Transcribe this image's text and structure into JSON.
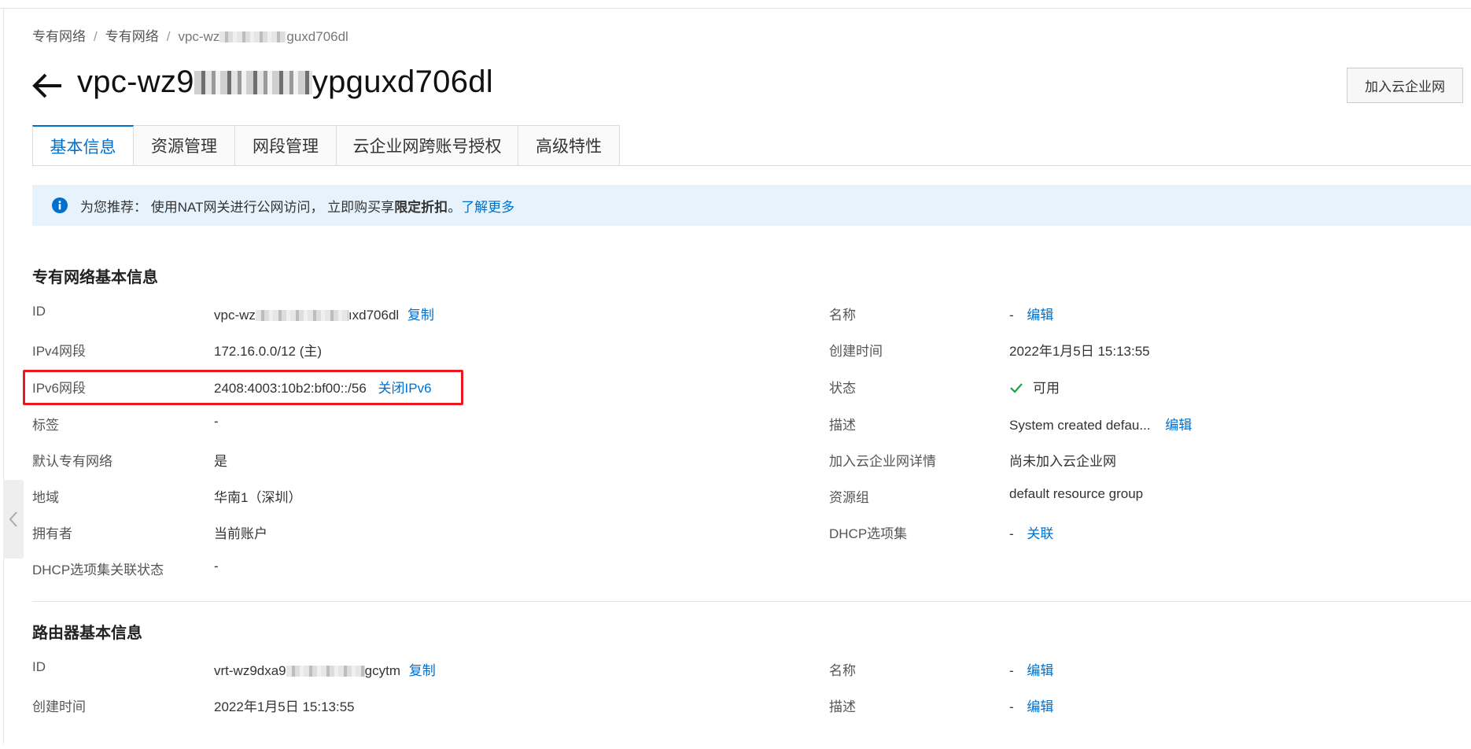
{
  "breadcrumb": {
    "items": [
      "专有网络",
      "专有网络"
    ],
    "current_prefix": "vpc-wz",
    "current_suffix": "guxd706dl",
    "separator": "/"
  },
  "title": {
    "prefix": "vpc-wz9",
    "suffix": "ypguxd706dl"
  },
  "header_button": "加入云企业网",
  "tabs": [
    "基本信息",
    "资源管理",
    "网段管理",
    "云企业网跨账号授权",
    "高级特性"
  ],
  "active_tab": "基本信息",
  "notice": {
    "icon": "info-icon",
    "text_prefix": "为您推荐：  使用NAT网关进行公网访问，  立即购买享",
    "text_bold": "限定折扣",
    "text_suffix": "。",
    "link": "了解更多"
  },
  "vpc_section": {
    "title": "专有网络基本信息",
    "left": [
      {
        "label": "ID",
        "value_prefix": "vpc-wz",
        "value_suffix": "ıxd706dl",
        "action": "复制"
      },
      {
        "label": "IPv4网段",
        "value": "172.16.0.0/12 (主)"
      },
      {
        "label": "IPv6网段",
        "value": "2408:4003:10b2:bf00::/56",
        "action": "关闭IPv6"
      },
      {
        "label": "标签",
        "value": "-"
      },
      {
        "label": "默认专有网络",
        "value": "是"
      },
      {
        "label": "地域",
        "value": "华南1（深圳）"
      },
      {
        "label": "拥有者",
        "value": "当前账户"
      },
      {
        "label": "DHCP选项集关联状态",
        "value": "-"
      }
    ],
    "right": [
      {
        "label": "名称",
        "value": "-",
        "action": "编辑"
      },
      {
        "label": "创建时间",
        "value": "2022年1月5日 15:13:55"
      },
      {
        "label": "状态",
        "value": "可用",
        "icon": "check-icon"
      },
      {
        "label": "描述",
        "value": "System created defau...",
        "action": "编辑"
      },
      {
        "label": "加入云企业网详情",
        "value": "尚未加入云企业网"
      },
      {
        "label": "资源组",
        "value": "default resource group"
      },
      {
        "label": "DHCP选项集",
        "value": "-",
        "action": "关联"
      }
    ]
  },
  "router_section": {
    "title": "路由器基本信息",
    "left": [
      {
        "label": "ID",
        "value_prefix": "vrt-wz9dxa9",
        "value_suffix": "gcytm",
        "action": "复制"
      },
      {
        "label": "创建时间",
        "value": "2022年1月5日 15:13:55"
      }
    ],
    "right": [
      {
        "label": "名称",
        "value": "-",
        "action": "编辑"
      },
      {
        "label": "描述",
        "value": "-",
        "action": "编辑"
      }
    ]
  },
  "colors": {
    "accent": "#0070cc",
    "notice_bg": "#e6f2fc",
    "highlight": "#e8191f",
    "success": "#1aa34a"
  }
}
